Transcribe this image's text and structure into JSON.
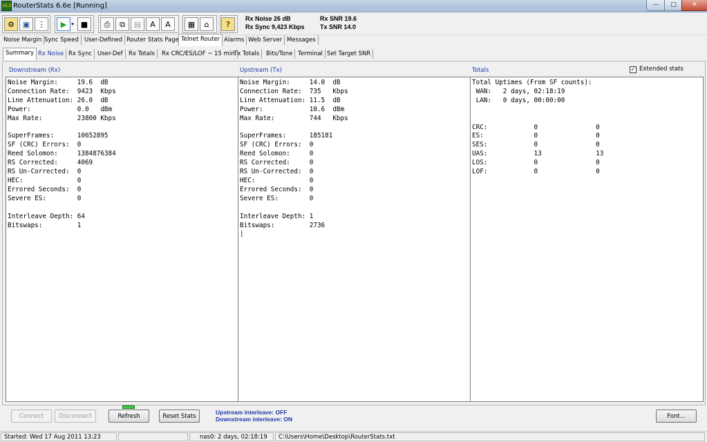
{
  "window": {
    "title": "RouterStats 6.6e   [Running]",
    "app_icon_text": "26.0",
    "controls": {
      "minimize": "—",
      "maximize": "□",
      "close": "✕"
    }
  },
  "toolbar": {
    "icons": [
      "connect-icon",
      "save-icon",
      "traffic-light-icon",
      "play-icon",
      "dropdown-arrow-icon",
      "stop-icon",
      "print-icon",
      "copy-icon",
      "paste-icon",
      "export-a-icon",
      "export-b-icon",
      "router-icon",
      "home-icon",
      "help-icon"
    ],
    "rx_noise": "Rx Noise 26 dB",
    "rx_sync": "Rx Sync  9,423 Kbps",
    "rx_snr": "Rx SNR  19.6",
    "tx_snr": "Tx SNR  14.0"
  },
  "tabs_top": [
    "Noise Margin",
    "Sync Speed",
    "User-Defined",
    "Router Stats Page",
    "Telnet Router",
    "Alarms",
    "Web Server",
    "Messages"
  ],
  "tabs_top_active": "Telnet Router",
  "tabs_sub": [
    "Summary",
    "Rx Noise",
    "Rx Sync",
    "User-Def",
    "Rx  Totals",
    "Rx CRC/ES/LOF ~ 15 min",
    "Tx  Totals",
    "Bits/Tone",
    "Terminal",
    "Set Target SNR"
  ],
  "tabs_sub_active": "Summary",
  "panes": {
    "downstream": {
      "title": "Downstream (Rx)",
      "text": "Noise Margin:     19.6  dB\nConnection Rate:  9423  Kbps\nLine Attenuation: 26.0  dB\nPower:            0.0   dBm\nMax Rate:         23800 Kbps\n\nSuperFrames:      10652895\nSF (CRC) Errors:  0\nReed Solomon:     1384876384\nRS Corrected:     4069\nRS Un-Corrected:  0\nHEC:              0\nErrored Seconds:  0\nSevere ES:        0\n\nInterleave Depth: 64\nBitswaps:         1"
    },
    "upstream": {
      "title": "Upstream (Tx)",
      "text": "Noise Margin:     14.0  dB\nConnection Rate:  735   Kbps\nLine Attenuation: 11.5  dB\nPower:            10.6  dBm\nMax Rate:         744   Kbps\n\nSuperFrames:      185181\nSF (CRC) Errors:  0\nReed Solomon:     0\nRS Corrected:     0\nRS Un-Corrected:  0\nHEC:              0\nErrored Seconds:  0\nSevere ES:        0\n\nInterleave Depth: 1\nBitswaps:         2736\n|"
    },
    "totals": {
      "title": "Totals",
      "text": "Total Uptimes (From SF counts):\n WAN:   2 days, 02:18:19\n LAN:   0 days, 00:00:00\n\n\nCRC:            0               0\nES:             0               0\nSES:            0               0\nUAS:            13              13\nLOS:            0               0\nLOF:            0               0"
    }
  },
  "extended_stats": {
    "label": "Extended stats",
    "checked_glyph": "✓"
  },
  "buttons": {
    "connect": "Connect",
    "disconnect": "Disconnect",
    "refresh": "Refresh",
    "reset_stats": "Reset Stats",
    "font": "Font..."
  },
  "interleave": {
    "upstream": "Upstream interleave:     OFF",
    "downstream": "Downstream interleave: ON"
  },
  "statusbar": {
    "started": "Started: Wed 17 Aug 2011   13:23",
    "empty": "",
    "nas": "nas0:  2 days, 02:18:19",
    "path": "C:\\Users\\Home\\Desktop\\RouterStats.txt"
  }
}
